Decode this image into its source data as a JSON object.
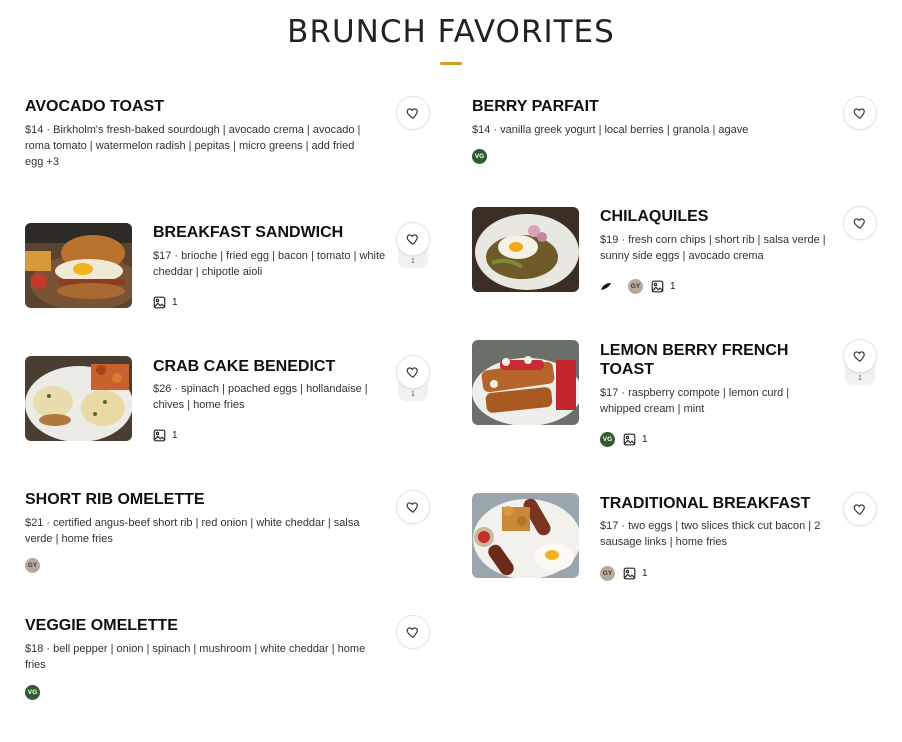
{
  "page": {
    "title": "BRUNCH FAVORITES",
    "accent_color": "#c9a227"
  },
  "dietary_badges": {
    "vg": {
      "label": "VG",
      "color": "#2f5d2f"
    },
    "gy": {
      "label": "GY",
      "color": "#b8a99a"
    }
  },
  "icons": {
    "favorite": "heart-icon",
    "photo": "image-icon",
    "spicy": "leaf-icon"
  },
  "items": [
    {
      "name": "AVOCADO TOAST",
      "desc": "$14 · Birkholm's fresh-baked sourdough | avocado crema | avocado | roma tomato | watermelon radish | pepitas | micro greens | add fried egg +3"
    },
    {
      "name": "BERRY PARFAIT",
      "desc": "$14 · vanilla greek yogurt | local berries | granola | agave"
    },
    {
      "name": "BREAKFAST SANDWICH",
      "desc": "$17 · brioche | fried egg | bacon | tomato | white cheddar | chipotle aioli",
      "photos": "1",
      "likes": "1"
    },
    {
      "name": "CHILAQUILES",
      "desc": "$19 · fresh corn chips | short rib | salsa verde | sunny side eggs | avocado crema",
      "photos": "1"
    },
    {
      "name": "CRAB CAKE BENEDICT",
      "desc": "$26 · spinach | poached eggs | hollandaise | chives | home fries",
      "photos": "1",
      "likes": "1"
    },
    {
      "name": "LEMON BERRY FRENCH TOAST",
      "desc": "$17 · raspberry compote | lemon curd | whipped cream | mint",
      "photos": "1",
      "likes": "1"
    },
    {
      "name": "SHORT RIB OMELETTE",
      "desc": "$21 · certified angus-beef short rib | red onion | white cheddar | salsa verde | home fries"
    },
    {
      "name": "TRADITIONAL BREAKFAST",
      "desc": "$17 · two eggs | two slices thick cut bacon | 2 sausage links | home fries",
      "photos": "1"
    },
    {
      "name": "VEGGIE OMELETTE",
      "desc": "$18 · bell pepper | onion | spinach | mushroom | white cheddar | home fries"
    }
  ]
}
